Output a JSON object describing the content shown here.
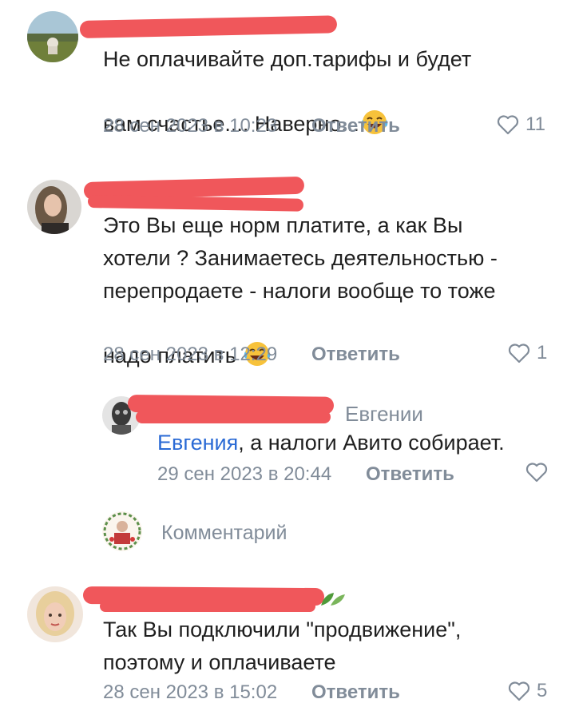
{
  "comments": [
    {
      "text": "Не оплачивайте доп.тарифы и будет\nвам счастье.... Наверно...",
      "emoji": "laughing-tears-emoji",
      "date": "28 сен 2023 в 10:23",
      "reply_label": "Ответить",
      "likes": "11"
    },
    {
      "text": "Это Вы еще норм платите, а как Вы\nхотели ? Занимаетесь деятельностью -\nперепродаете - налоги вообще то тоже\nнадо платить",
      "emoji": "laughing-tears-emoji",
      "date": "28 сен 2023 в 12:29",
      "reply_label": "Ответить",
      "likes": "1"
    },
    {
      "author_suffix": "Евгении",
      "mention": "Евгения",
      "text": ", а налоги Авито собирает.",
      "date": "29 сен 2023 в 20:44",
      "reply_label": "Ответить"
    },
    {
      "text": "Так Вы подключили \"продвижение\",\nпоэтому и оплачиваете",
      "date": "28 сен 2023 в 15:02",
      "reply_label": "Ответить",
      "likes": "5"
    }
  ],
  "compose": {
    "placeholder": "Комментарий"
  },
  "colors": {
    "accent": "#2a6ad5",
    "muted": "#818c99",
    "redaction": "#f0575b"
  }
}
